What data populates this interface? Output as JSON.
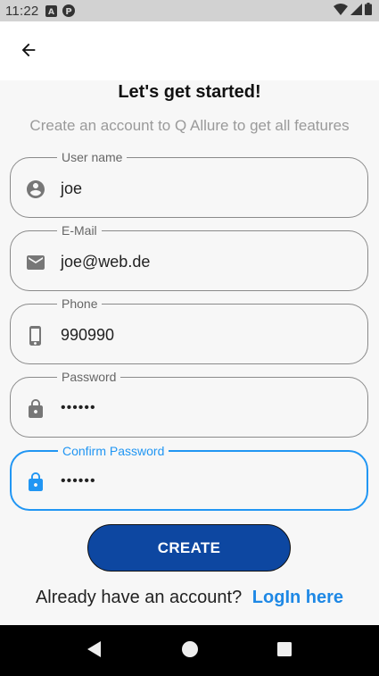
{
  "status_bar": {
    "time": "11:22",
    "icons": [
      "a-notification-icon",
      "p-notification-icon",
      "wifi-icon",
      "signal-icon",
      "battery-icon"
    ]
  },
  "app_bar": {
    "back_icon": "arrow-left-icon"
  },
  "header": {
    "title": "Let's get started!",
    "subtitle": "Create an account to Q Allure to get all features"
  },
  "form": {
    "username": {
      "label": "User name",
      "value": "joe",
      "icon": "account-circle-icon"
    },
    "email": {
      "label": "E-Mail",
      "value": "joe@web.de",
      "icon": "mail-icon"
    },
    "phone": {
      "label": "Phone",
      "value": "990990",
      "icon": "phone-icon"
    },
    "password": {
      "label": "Password",
      "value": "••••••",
      "icon": "lock-icon"
    },
    "confirm_password": {
      "label": "Confirm Password",
      "value": "••••••",
      "icon": "lock-icon",
      "focused": true
    }
  },
  "create_button": {
    "label": "CREATE"
  },
  "login_prompt": {
    "text": "Already have an account?",
    "link": "LogIn here"
  },
  "colors": {
    "accent": "#2196f3",
    "button": "#0d47a1",
    "link": "#1e88e5"
  }
}
